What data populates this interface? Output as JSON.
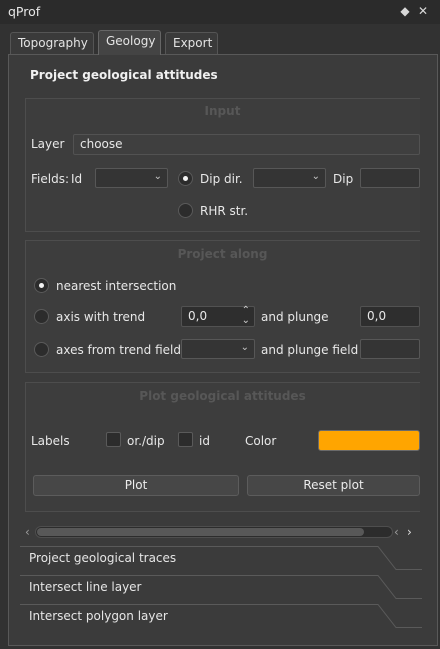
{
  "window": {
    "title": "qProf"
  },
  "tabs": [
    {
      "label": "Topography",
      "active": false
    },
    {
      "label": "Geology",
      "active": true
    },
    {
      "label": "Export",
      "active": false
    }
  ],
  "section_title": "Project geological attitudes",
  "input_group": {
    "title": "Input",
    "layer_label": "Layer",
    "layer_value": "choose",
    "fields_label": "Fields:",
    "id_label": "Id",
    "id_value": "",
    "dipdir_option": "Dip dir.",
    "dipdir_value": "",
    "dip_label": "Dip",
    "dip_value": "",
    "rhr_option": "RHR str.",
    "dipdir_checked": true
  },
  "project_group": {
    "title": "Project along",
    "nearest_option": "nearest intersection",
    "axis_option": "axis with trend",
    "trend_value": "0,0",
    "plunge_label": "and plunge",
    "plunge_value": "0,0",
    "axes_field_option": "axes from trend field",
    "trend_field_value": "",
    "plunge_field_label": "and plunge field",
    "plunge_field_value": "",
    "nearest_checked": true
  },
  "plot_group": {
    "title": "Plot geological attitudes",
    "labels_label": "Labels",
    "or_dip_label": "or./dip",
    "id_label": "id",
    "color_label": "Color",
    "color_value": "#ffa500",
    "plot_button": "Plot",
    "reset_button": "Reset plot"
  },
  "toolbox_sections": [
    "Project geological traces",
    "Intersect line layer",
    "Intersect polygon layer"
  ],
  "colors": {
    "accent_orange": "#ffa500",
    "panel_bg": "#3b3b3b",
    "window_bg": "#323232"
  },
  "icons": {
    "float": "diamond-icon",
    "close": "close-icon",
    "combo": "chevron-down-icon",
    "spin": "spin-arrows-icon",
    "scroll_left": "chevron-left-icon",
    "scroll_right": "chevron-right-icon"
  }
}
